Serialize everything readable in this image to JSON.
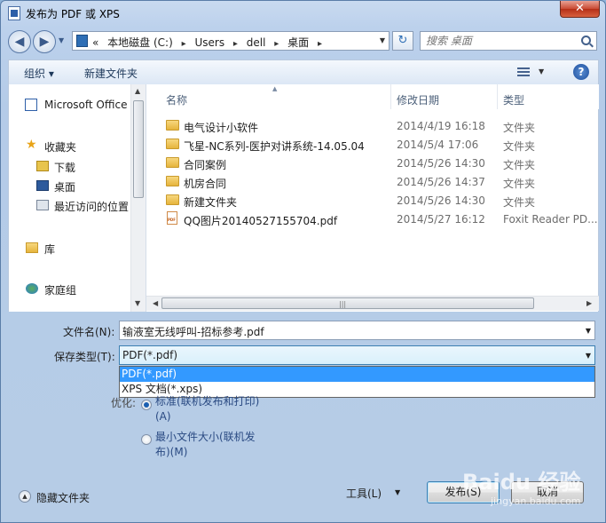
{
  "window": {
    "title": "发布为 PDF 或 XPS",
    "close_label": "✕"
  },
  "address": {
    "back": "◀",
    "forward": "▶",
    "prefix": "«",
    "crumbs": [
      "本地磁盘 (C:)",
      "Users",
      "dell",
      "桌面"
    ],
    "separator": "▸",
    "refresh": "↻"
  },
  "search": {
    "placeholder": "搜索 桌面"
  },
  "toolbar": {
    "organize": "组织 ▾",
    "new_folder": "新建文件夹",
    "help": "?"
  },
  "nav": {
    "items": [
      "Microsoft Office ",
      "收藏夹",
      "下载",
      "桌面",
      "最近访问的位置",
      "库",
      "家庭组"
    ]
  },
  "columns": {
    "name": "名称",
    "date": "修改日期",
    "type": "类型"
  },
  "files": [
    {
      "name": "电气设计小软件",
      "date": "2014/4/19 16:18",
      "type": "文件夹",
      "icon": "folder-icon"
    },
    {
      "name": "飞星-NC系列-医护对讲系统-14.05.04",
      "date": "2014/5/4 17:06",
      "type": "文件夹",
      "icon": "folder-icon"
    },
    {
      "name": "合同案例",
      "date": "2014/5/26 14:30",
      "type": "文件夹",
      "icon": "folder-icon"
    },
    {
      "name": "机房合同",
      "date": "2014/5/26 14:37",
      "type": "文件夹",
      "icon": "folder-icon"
    },
    {
      "name": "新建文件夹",
      "date": "2014/5/26 14:30",
      "type": "文件夹",
      "icon": "folder-icon"
    },
    {
      "name": "QQ图片20140527155704.pdf",
      "date": "2014/5/27 16:12",
      "type": "Foxit Reader PD...",
      "icon": "pdf-icon"
    }
  ],
  "form": {
    "filename_label": "文件名(N):",
    "filename_value": "输液室无线呼叫-招标参考.pdf",
    "type_label": "保存类型(T):",
    "type_value": "PDF(*.pdf)",
    "type_options": [
      "PDF(*.pdf)",
      "XPS 文档(*.xps)"
    ],
    "optimize_label": "优化:",
    "opt_standard": "标准(联机发布和打印)",
    "opt_standard_hotkey": "(A)",
    "opt_minimum": "最小文件大小(联机发",
    "opt_minimum_line2": "布)(M)"
  },
  "footer": {
    "hide_folders": "隐藏文件夹",
    "tools": "工具(L)",
    "save": "发布(S)",
    "cancel": "取消"
  },
  "watermark": {
    "main": "Baidu 经验",
    "sub": "jingyan.baidu.com"
  }
}
